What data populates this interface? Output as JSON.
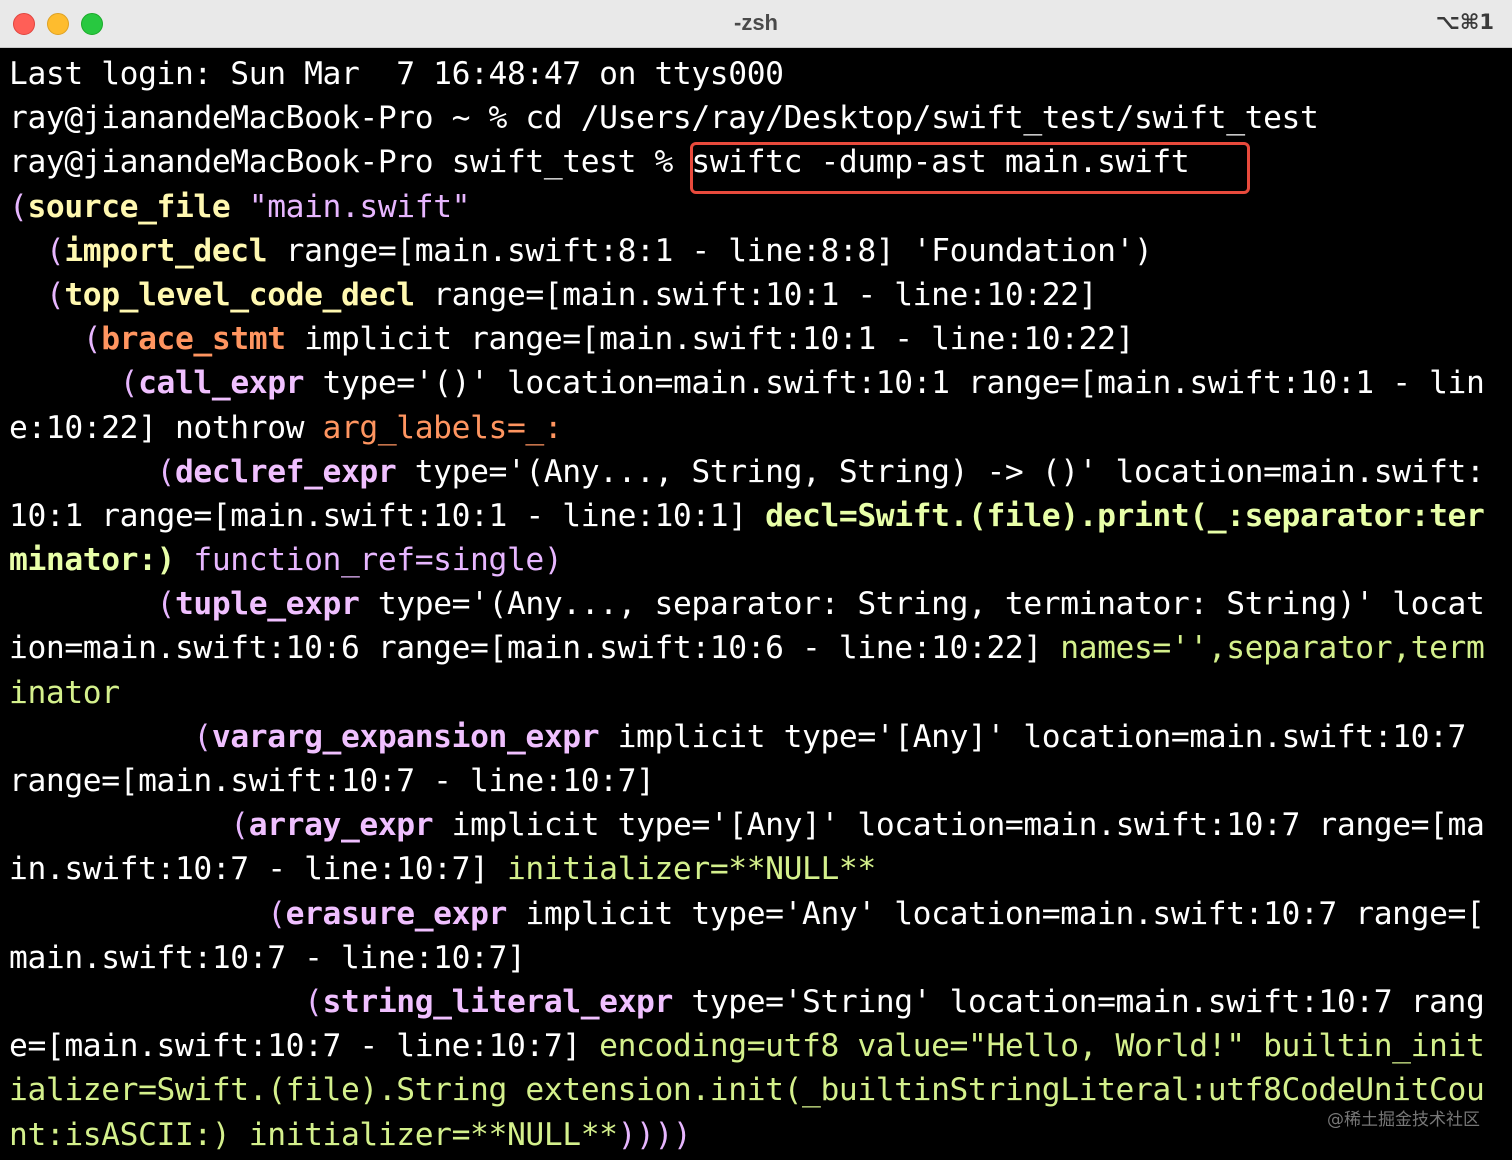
{
  "window": {
    "title": "-zsh",
    "shortcut": "⌥⌘1",
    "watermark": "@稀土掘金技术社区"
  },
  "terminal": {
    "l1": "Last login: Sun Mar  7 16:48:47 on ttys000",
    "l2": "ray@jianandeMacBook-Pro ~ % cd /Users/ray/Desktop/swift_test/swift_test",
    "l3_prompt": "ray@jianandeMacBook-Pro swift_test % ",
    "l3_cmd": "swiftc -dump-ast main.swift",
    "l4a": "(",
    "l4b": "source_file",
    "l4c": " \"main.swift\"",
    "l5a": "  (",
    "l5b": "import_decl",
    "l5c": " range=[main.swift:8:1 - line:8:8] 'Foundation')",
    "l6a": "  (",
    "l6b": "top_level_code_decl",
    "l6c": " range=[main.swift:10:1 - line:10:22]",
    "l7a": "    (",
    "l7b": "brace_stmt",
    "l7c": " implicit range=[main.swift:10:1 - line:10:22]",
    "l8a": "      (",
    "l8b": "call_expr",
    "l8c": " type='()' location=main.swift:10:1 range=[main.swift:10:1 - lin",
    "l9a": "e:10:22] nothrow ",
    "l9b": "arg_labels=_:",
    "l10a": "        (",
    "l10b": "declref_expr",
    "l10c": " type='(Any..., String, String) -> ()' location=main.swift:",
    "l11a": "10:1 range=[main.swift:10:1 - line:10:1] ",
    "l11b": "decl=Swift.(file).print(_:separator:ter",
    "l12a": "minator:)",
    "l12b": " function_ref=single)",
    "l13a": "        (",
    "l13b": "tuple_expr",
    "l13c": " type='(Any..., separator: String, terminator: String)' locat",
    "l14a": "ion=main.swift:10:6 range=[main.swift:10:6 - line:10:22] ",
    "l14b": "names='',separator,term",
    "l15": "inator",
    "l16a": "          (",
    "l16b": "vararg_expansion_expr",
    "l16c": " implicit type='[Any]' location=main.swift:10:7",
    "l17": "range=[main.swift:10:7 - line:10:7]",
    "l18a": "            (",
    "l18b": "array_expr",
    "l18c": " implicit type='[Any]' location=main.swift:10:7 range=[ma",
    "l19a": "in.swift:10:7 - line:10:7] ",
    "l19b": "initializer=**NULL**",
    "l20a": "              (",
    "l20b": "erasure_expr",
    "l20c": " implicit type='Any' location=main.swift:10:7 range=[",
    "l21": "main.swift:10:7 - line:10:7]",
    "l22a": "                (",
    "l22b": "string_literal_expr",
    "l22c": " type='String' location=main.swift:10:7 rang",
    "l23a": "e=[main.swift:10:7 - line:10:7] ",
    "l23b": "encoding=utf8 value=\"Hello, World!\" builtin_init",
    "l24": "ializer=Swift.(file).String extension.init(_builtinStringLiteral:utf8CodeUnitCou",
    "l25a": "nt:isASCII:) initializer=**NULL**",
    "l25b": "))))"
  }
}
